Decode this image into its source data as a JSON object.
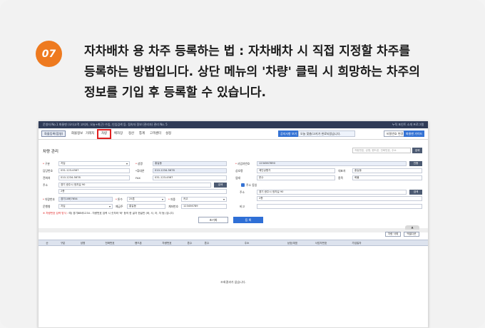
{
  "step": {
    "number": "07",
    "lines": [
      "자차배차 용 차주 등록하는 법 : 자차배차 시 직접 지정할 차주를",
      "등록하는 방법입니다. 상단 메뉴의 '차량' 클릭 시 희망하는 차주의",
      "정보를 기입 후 등록할 수 있습니다."
    ]
  },
  "app": {
    "titlebar": "운영자 No.1 화물맨 (오더고객 고지자, 오늘+최근) 수입, 인입검색 등. 접속자 정보 (관리자) 관리 No. 5",
    "titlebar_right": "누적 포인트 소개  프로그램",
    "menubar": {
      "home": "화물등록(합영)",
      "items": [
        "화물정보",
        "거래처",
        "차량",
        "배차장",
        "정산",
        "통계",
        "고객센터",
        "설정"
      ],
      "notice_btn": "공지사항 보기",
      "notice_text": "오늘 맞춤/고지가 완료되었습니다.",
      "pw_btn": "비밀번호 변경",
      "guide_btn": "화물맨 가이드"
    },
    "page_title": "차량 관리",
    "search_placeholder": "차량번호, 성명, 핸드폰, 전화번호, 주소",
    "search_btn": "검색",
    "form": {
      "gubun_label": "구분",
      "gubun_value": "지입",
      "name_label": "성명",
      "name_value": "홍길동",
      "biz_label": "사업자번호",
      "biz_value": "1234567890",
      "biz_btn": "인증",
      "homepage_label": "담당번호",
      "homepage_value": "031-123-4567",
      "fax2_label": "*휴대폰",
      "fax2_value": "010-1234-5678",
      "company_label": "상호명",
      "company_value": "제인상협가",
      "ceo_label": "대표자",
      "ceo_value": "홍길동",
      "tel_label": "전화처",
      "tel_value": "010-1234-5678",
      "fax_label": "FAX",
      "fax_value": "031-123-4567",
      "upjong_label": "업태",
      "upjong_value": "운수",
      "jongmok_label": "종목",
      "jongmok_value": "화물",
      "addr_label": "주소",
      "addr_value": "경기 광주시 정지길 90",
      "addr_btn": "검색",
      "addr_detail": "2층",
      "same_addr_label": "주소 동일",
      "addr2_label": "주소",
      "addr2_value": "경기 광주시 정지길 90",
      "addr2_btn": "검색",
      "addr2_detail": "2층",
      "carno_label": "차량번호",
      "carno_value": "경기10바7654",
      "ton_label": "톤수",
      "ton_value": "25톤",
      "cartype_label": "차종",
      "cartype_value": "카고",
      "driver_label": "운행형",
      "driver_value": "지입",
      "owner_label": "예금주",
      "owner_value": "홍길동",
      "account_label": "계좌번호",
      "account_value": "123456789",
      "memo_label": "비고",
      "hint_red": "※ 차량번호 입력 방식 :",
      "hint_text": "예) 경기88바1234 - 차량번호 입력 시 숫자와 '바' 등의 한 글자 한글만 (바, 사, 아, 자 등) 입니다."
    },
    "btn_reset": "초기화",
    "btn_register": "등 록",
    "fold_label": "▲",
    "toolbar": [
      "차량 삭제",
      "엑셀다운"
    ],
    "grid_columns": [
      "순",
      "구분",
      "성명",
      "전화번호",
      "핸드폰",
      "차량번호",
      "톤수",
      "톤수",
      "주소",
      "상호/대표",
      "사업자번호",
      "가입일자"
    ],
    "grid_empty": "조회결과가 없습니다."
  }
}
